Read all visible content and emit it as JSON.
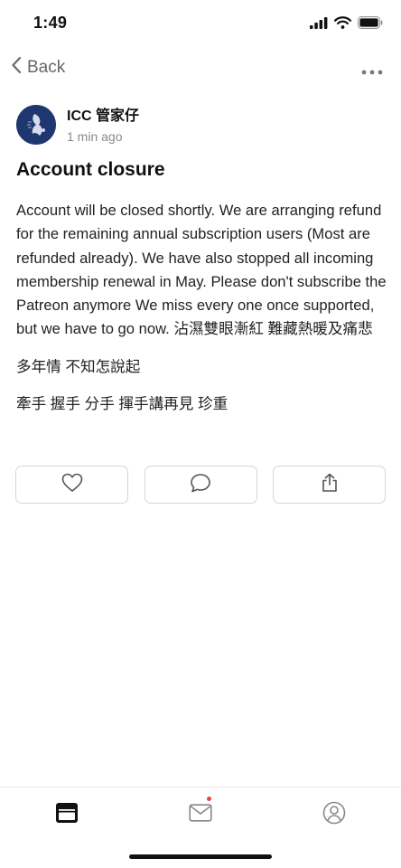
{
  "status_bar": {
    "time": "1:49"
  },
  "nav": {
    "back_label": "Back"
  },
  "author": {
    "name": "ICC 管家仔",
    "time": "1 min ago"
  },
  "post": {
    "title": "Account closure",
    "paragraphs": [
      "Account will be closed shortly. We are arranging refund for the remaining annual subscription users (Most are refunded already). We have also stopped all incoming membership renewal in May. Please don't subscribe the Patreon anymore We miss every one once supported, but we have to go now.  沾濕雙眼漸紅 難藏熱暖及痛悲",
      "多年情 不知怎說起",
      "牽手 握手 分手 揮手講再見 珍重"
    ]
  },
  "actions": [
    "heart-icon",
    "comment-icon",
    "share-icon"
  ],
  "tabs": [
    "home-icon",
    "inbox-icon",
    "profile-icon"
  ],
  "colors": {
    "notification_dot": "#e84545",
    "muted_text": "#8a8a8a"
  }
}
